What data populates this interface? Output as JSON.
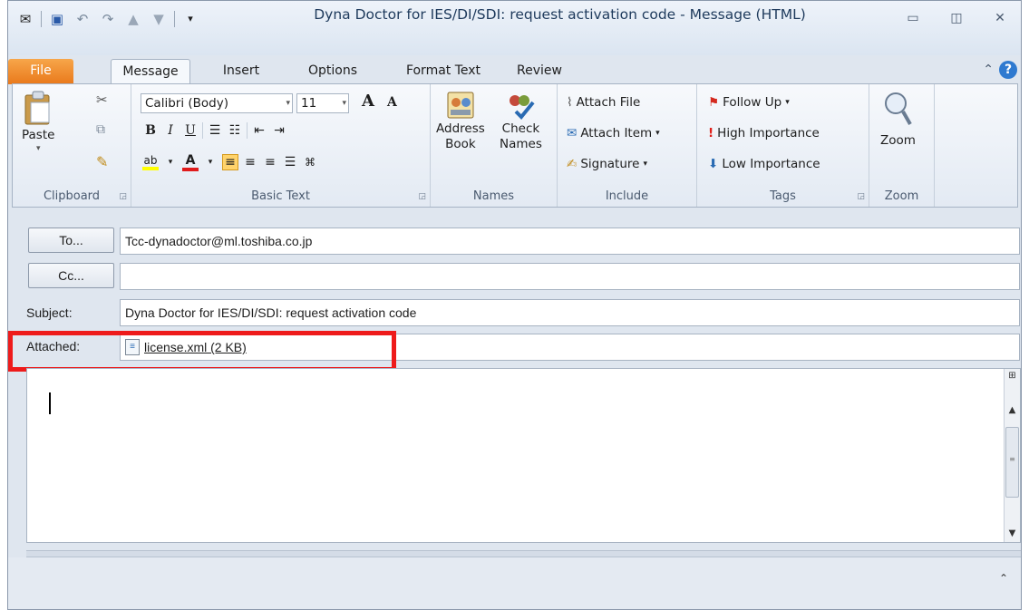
{
  "window": {
    "title": "Dyna Doctor for IES/DI/SDI: request activation code  -  Message (HTML)"
  },
  "tabs": [
    "File",
    "Message",
    "Insert",
    "Options",
    "Format Text",
    "Review"
  ],
  "ribbon": {
    "clipboard": {
      "label": "Clipboard",
      "paste": "Paste"
    },
    "basic_text": {
      "label": "Basic Text",
      "font": "Calibri (Body)",
      "size": "11"
    },
    "names": {
      "label": "Names",
      "address_book": "Address\nBook",
      "address_book_1": "Address",
      "address_book_2": "Book",
      "check_names_1": "Check",
      "check_names_2": "Names"
    },
    "include": {
      "label": "Include",
      "attach_file": "Attach File",
      "attach_item": "Attach Item",
      "signature": "Signature"
    },
    "tags": {
      "label": "Tags",
      "follow_up": "Follow Up",
      "high_importance": "High Importance",
      "low_importance": "Low Importance"
    },
    "zoom": {
      "label": "Zoom",
      "zoom_button": "Zoom"
    }
  },
  "header": {
    "to_label": "To...",
    "to_value": "Tcc-dynadoctor@ml.toshiba.co.jp",
    "cc_label": "Cc...",
    "cc_value": "",
    "subject_label": "Subject:",
    "subject_value": "Dyna Doctor for IES/DI/SDI: request activation code",
    "attached_label": "Attached:",
    "attachment": "license.xml (2 KB)"
  },
  "colors": {
    "file_tab": "#e9791b",
    "highlight": "#ee1b1b",
    "help": "#2f7ad0"
  }
}
